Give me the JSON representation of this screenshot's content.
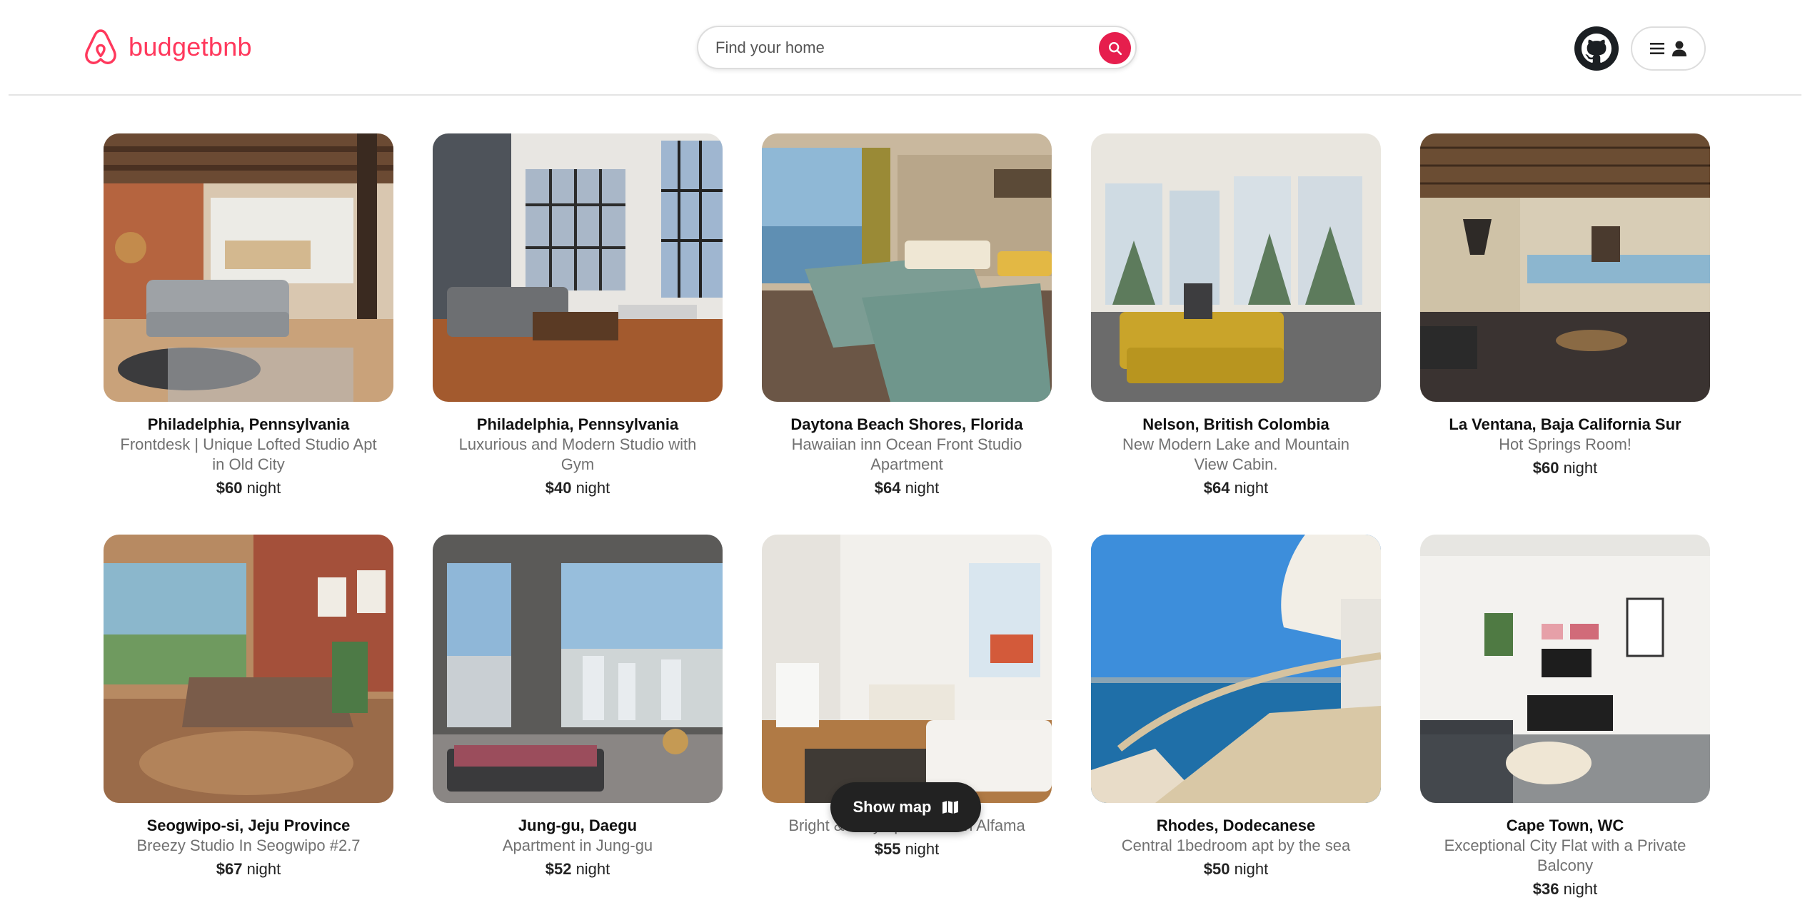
{
  "header": {
    "brand": "budgetbnb",
    "search_placeholder": "Find your home"
  },
  "listings": [
    {
      "location": "Philadelphia, Pennsylvania",
      "title": "Frontdesk | Unique Lofted Studio Apt in Old City",
      "price": "$60",
      "unit": "night"
    },
    {
      "location": "Philadelphia, Pennsylvania",
      "title": "Luxurious and Modern Studio with Gym",
      "price": "$40",
      "unit": "night"
    },
    {
      "location": "Daytona Beach Shores, Florida",
      "title": "Hawaiian inn Ocean Front Studio Apartment",
      "price": "$64",
      "unit": "night"
    },
    {
      "location": "Nelson, British Colombia",
      "title": "New Modern Lake and Mountain View Cabin.",
      "price": "$64",
      "unit": "night"
    },
    {
      "location": "La Ventana, Baja California Sur",
      "title": "Hot Springs Room!",
      "price": "$60",
      "unit": "night"
    },
    {
      "location": "Seogwipo-si, Jeju Province",
      "title": "Breezy Studio In Seogwipo #2.7",
      "price": "$67",
      "unit": "night"
    },
    {
      "location": "Jung-gu, Daegu",
      "title": "Apartment in Jung-gu",
      "price": "$52",
      "unit": "night"
    },
    {
      "location": "",
      "title": "Bright & cozy apartment in Alfama",
      "price": "$55",
      "unit": "night"
    },
    {
      "location": "Rhodes, Dodecanese",
      "title": "Central 1bedroom apt by the sea",
      "price": "$50",
      "unit": "night"
    },
    {
      "location": "Cape Town, WC",
      "title": "Exceptional City Flat with a Private Balcony",
      "price": "$36",
      "unit": "night"
    }
  ],
  "map_button": {
    "label": "Show map"
  },
  "colors": {
    "brand": "#ff385c",
    "search_button": "#e61e4d",
    "map_button": "#222222"
  }
}
